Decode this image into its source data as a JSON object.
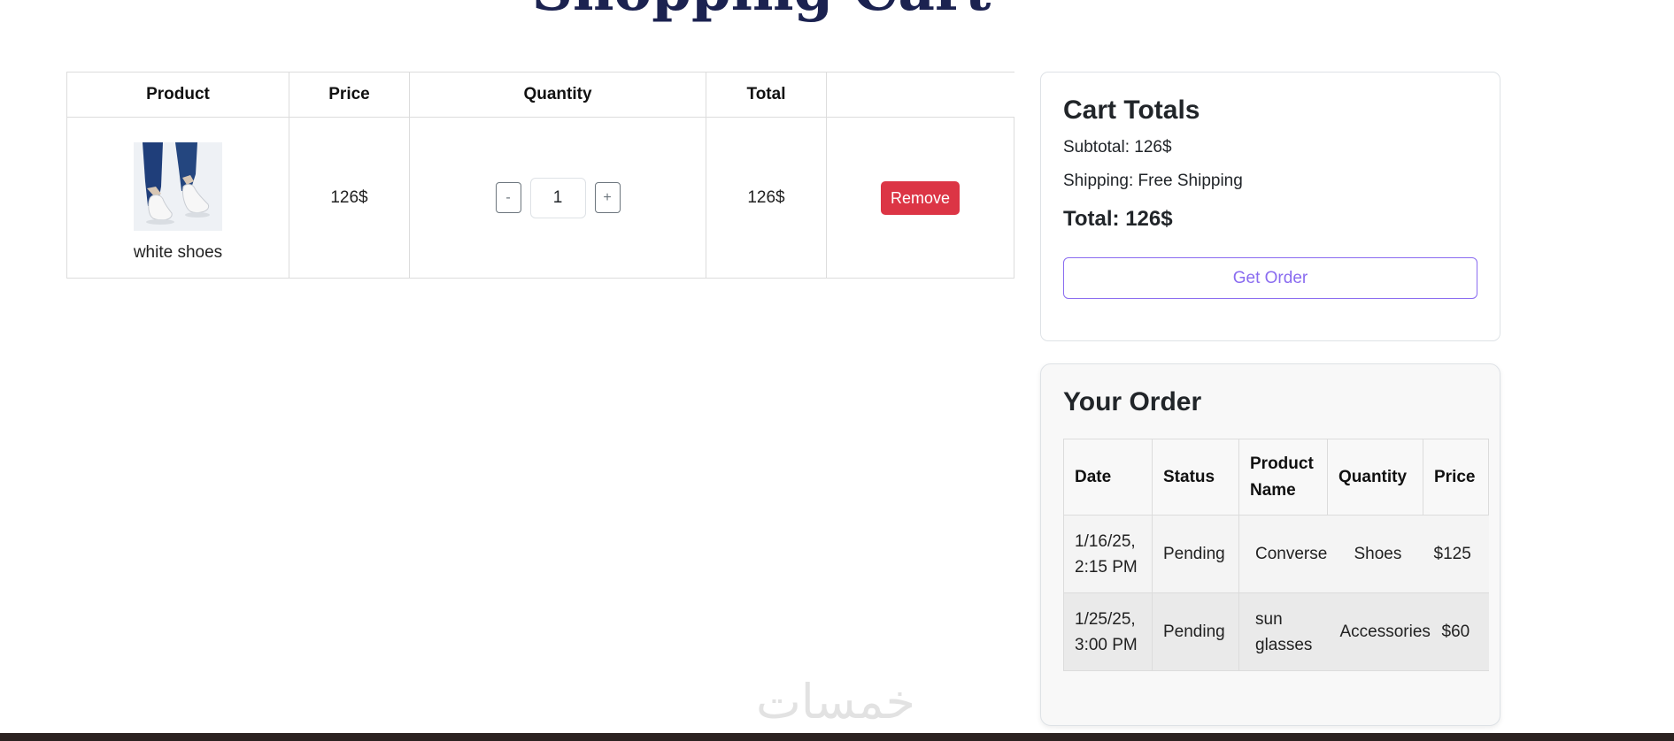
{
  "page": {
    "title": "Shopping Cart"
  },
  "cart_table": {
    "headers": [
      "Product",
      "Price",
      "Quantity",
      "Total",
      ""
    ],
    "rows": [
      {
        "product_name": "white shoes",
        "product_image": "white-shoes-photo",
        "price": "126$",
        "quantity": "1",
        "decrement_label": "-",
        "increment_label": "+",
        "total": "126$",
        "remove_label": "Remove"
      }
    ]
  },
  "cart_totals": {
    "title": "Cart Totals",
    "subtotal": "Subtotal: 126$",
    "shipping": "Shipping: Free Shipping",
    "total": "Total: 126$",
    "order_button": "Get Order"
  },
  "your_order": {
    "title": "Your Order",
    "headers": [
      "Date",
      "Status",
      "Product Name",
      "Quantity",
      "Price"
    ],
    "rows": [
      {
        "date": "1/16/25, 2:15 PM",
        "status": "Pending",
        "product_name": "Converse",
        "quantity": "Shoes",
        "price": "$125"
      },
      {
        "date": "1/25/25, 3:00 PM",
        "status": "Pending",
        "product_name": "sun glasses",
        "quantity": "Accessories",
        "price": "$60"
      }
    ]
  },
  "watermark": {
    "text": "خمسات"
  },
  "colors": {
    "title": "#1b2250",
    "remove": "#dc3545",
    "order_button": "#8a6cf0",
    "bottom_bar": "#2b2220"
  }
}
